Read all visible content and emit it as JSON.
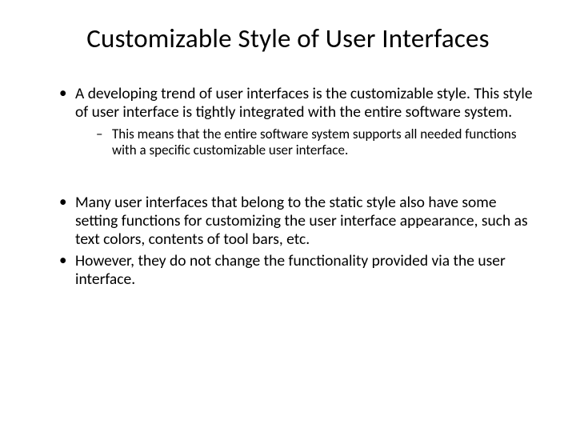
{
  "title": "Customizable Style of User Interfaces",
  "bullets": {
    "b1": "A developing trend of user interfaces is the customizable style. This style of user interface is tightly integrated with the entire software system.",
    "b1_sub1": "This means that the entire software system supports all needed functions with a specific customizable user interface.",
    "b2": "Many user interfaces that belong to the static style also have some setting functions for customizing the user interface appearance, such as text colors, contents of tool bars, etc.",
    "b3": "However, they do not change the functionality provided via the user interface."
  }
}
